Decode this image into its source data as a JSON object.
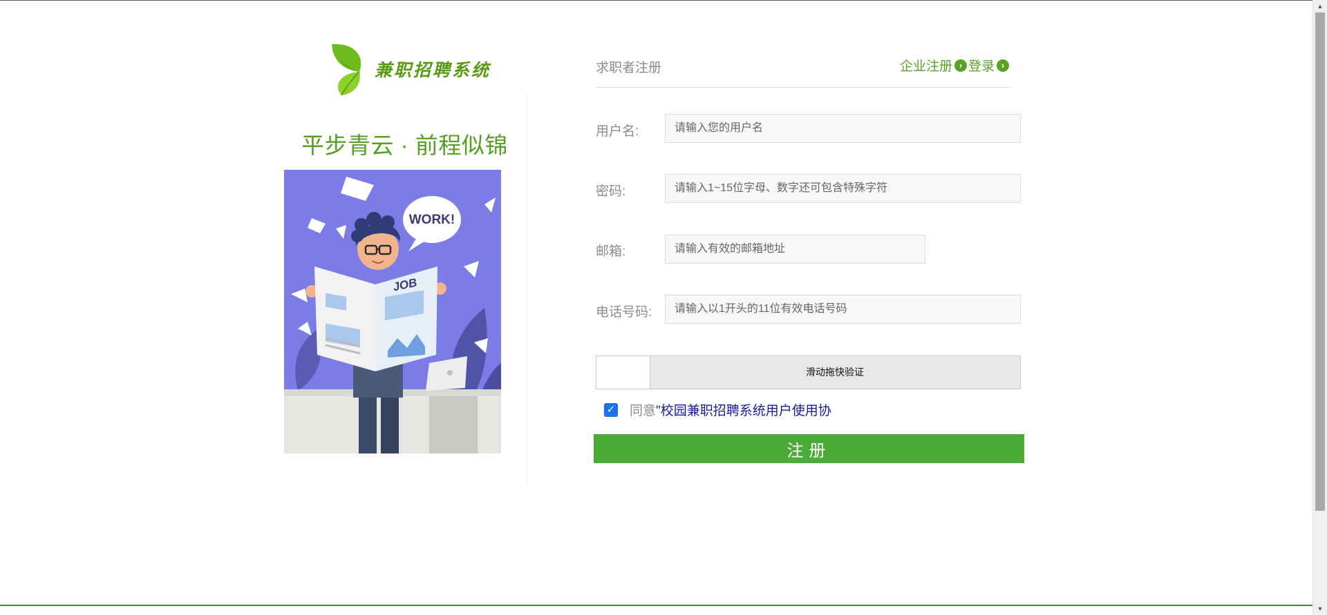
{
  "brand": {
    "logo_text": "兼职招聘系统",
    "slogan": "平步青云 · 前程似锦",
    "illustration_texts": {
      "bubble": "WORK!",
      "newspaper": "JOB"
    }
  },
  "header": {
    "title": "求职者注册",
    "company_register_link": "企业注册",
    "login_link": "登录"
  },
  "form": {
    "username": {
      "label": "用户名:",
      "value": "",
      "placeholder": "请输入您的用户名"
    },
    "password": {
      "label": "密码:",
      "value": "",
      "placeholder": "请输入1~15位字母、数字还可包含特殊字符"
    },
    "email": {
      "label": "邮箱:",
      "value": "",
      "placeholder": "请输入有效的邮箱地址"
    },
    "phone": {
      "label": "电话号码:",
      "value": "",
      "placeholder": "请输入以1开头的11位有效电话号码"
    },
    "slider_text": "滑动拖快验证",
    "agree_prefix": "同意",
    "agree_link": "\"校园兼职招聘系统用户使用协",
    "agree_checked": true,
    "submit_label": "注册"
  },
  "colors": {
    "brand_green": "#57a326",
    "button_green": "#4aab36",
    "link_blue": "#1a1a9c",
    "checkbox_blue": "#1a73e8"
  },
  "icons": [
    "leaf-logo-icon",
    "chevron-right-circle-icon",
    "checkmark-icon",
    "scroll-up-arrow-icon",
    "scroll-down-arrow-icon"
  ]
}
